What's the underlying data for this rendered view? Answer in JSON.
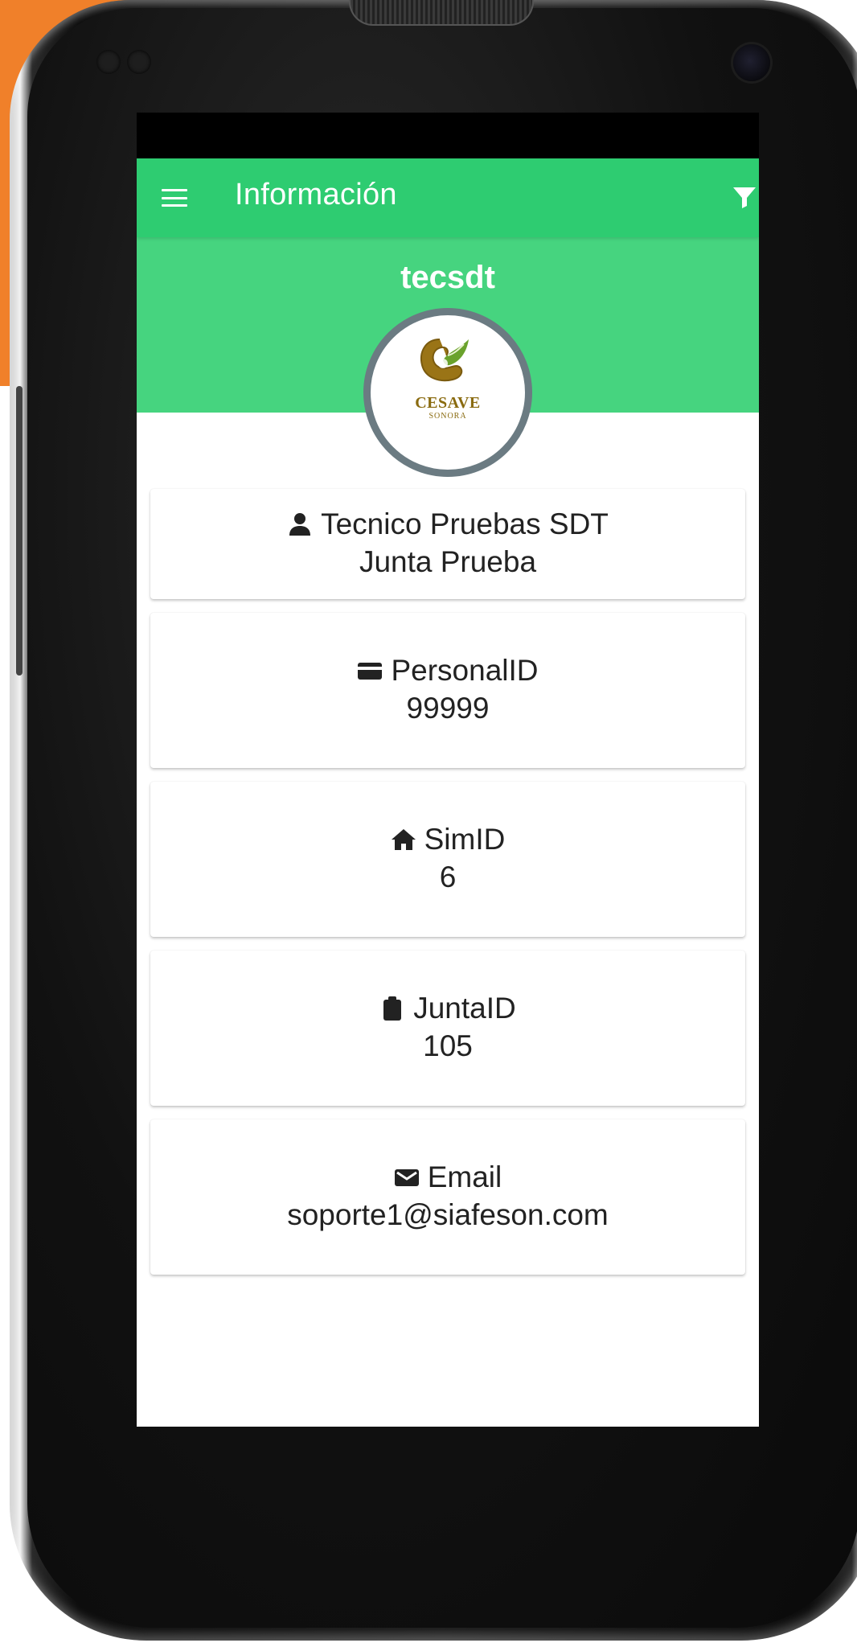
{
  "app_bar": {
    "title": "Información"
  },
  "profile": {
    "username": "tecsdt",
    "logo_text": "CESAVE",
    "logo_subtext": "SONORA"
  },
  "cards": [
    {
      "icon": "person-icon",
      "line1": "Tecnico Pruebas SDT",
      "line2": "Junta Prueba"
    },
    {
      "icon": "id-card-icon",
      "label": "PersonalID",
      "value": "99999"
    },
    {
      "icon": "home-icon",
      "label": "SimID",
      "value": "6"
    },
    {
      "icon": "clipboard-icon",
      "label": "JuntaID",
      "value": "105"
    },
    {
      "icon": "email-icon",
      "label": "Email",
      "value": "soporte1@siafeson.com"
    }
  ],
  "colors": {
    "app_bar": "#2ecc71",
    "header": "#46d47f",
    "avatar_border": "#6b7b82",
    "accent_orange": "#f0802a"
  }
}
